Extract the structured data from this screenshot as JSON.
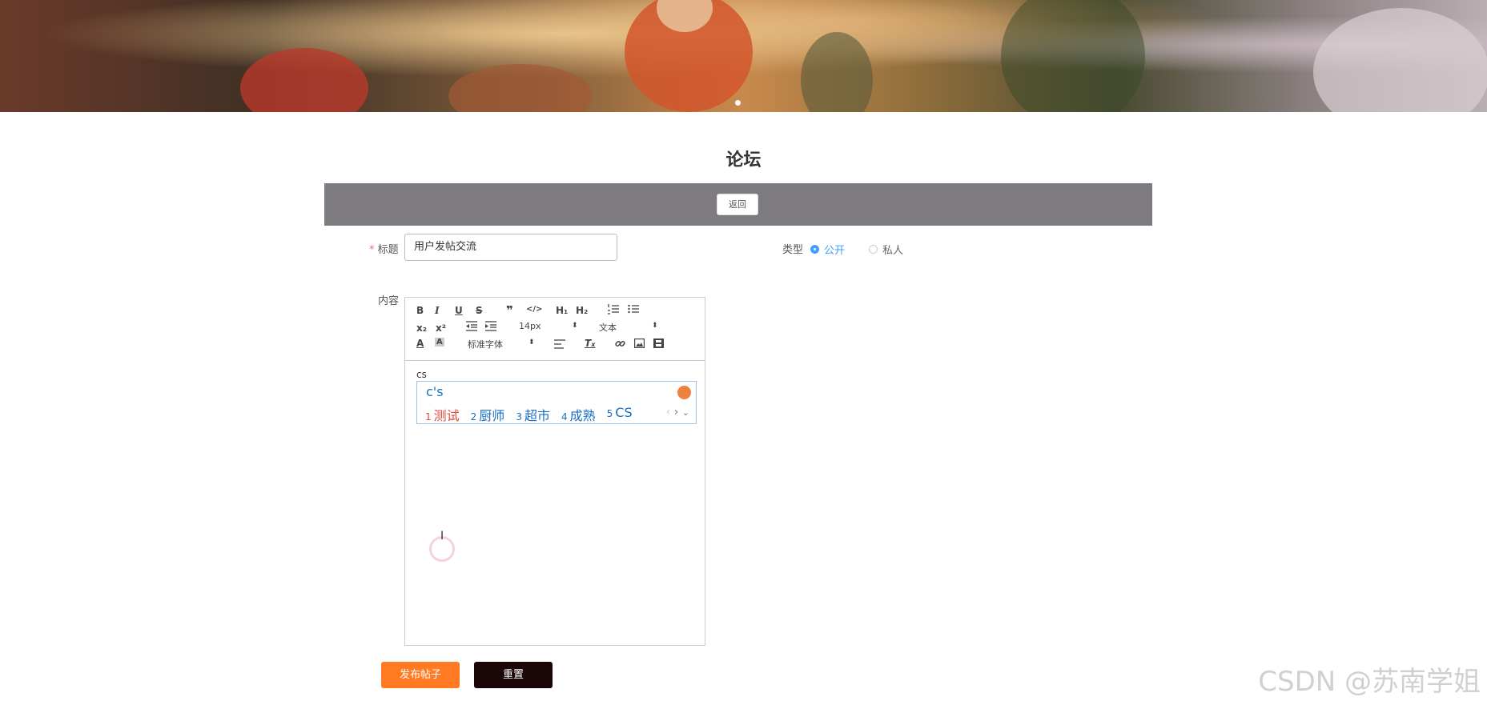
{
  "page": {
    "title": "论坛",
    "watermark": "CSDN @苏南学姐"
  },
  "banner": {
    "indicator_active": 1
  },
  "actions_bar": {
    "back_label": "返回"
  },
  "form": {
    "title_label": "标题",
    "title_value": "用户发帖交流",
    "type_label": "类型",
    "type_options": [
      "公开",
      "私人"
    ],
    "type_selected": "公开",
    "content_label": "内容",
    "required_mark": "*"
  },
  "editor": {
    "toolbar": {
      "font_size": "14px",
      "block_format": "文本",
      "font_family": "标准字体"
    },
    "content_text": "cs"
  },
  "ime": {
    "composition": "c's",
    "candidates": [
      {
        "num": "1",
        "text": "测试"
      },
      {
        "num": "2",
        "text": "厨师"
      },
      {
        "num": "3",
        "text": "超市"
      },
      {
        "num": "4",
        "text": "成熟"
      },
      {
        "num": "5",
        "text": "CS"
      }
    ]
  },
  "buttons": {
    "submit_label": "发布帖子",
    "reset_label": "重置"
  },
  "colors": {
    "primary": "#409eff",
    "submit": "#ff7a21",
    "reset": "#1a0607",
    "bar": "#7d7b80",
    "ime_text": "#1a6fc0",
    "ime_first": "#e0463a"
  }
}
